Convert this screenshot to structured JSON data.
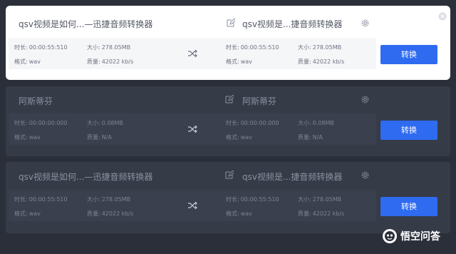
{
  "items": [
    {
      "src_name": "qsv视频是如何...—迅捷音频转换器",
      "dst_name": "qsv视频是...捷音频转换器",
      "src": {
        "duration_label": "时长:",
        "duration": "00:00:55:510",
        "size_label": "大小:",
        "size": "278.05MB",
        "format_label": "格式:",
        "format": "wav",
        "quality_label": "质量:",
        "quality": "42022 kb/s"
      },
      "dst": {
        "duration_label": "时长:",
        "duration": "00:00:55:510",
        "size_label": "大小:",
        "size": "278.05MB",
        "format_label": "格式:",
        "format": "wav",
        "quality_label": "质量:",
        "quality": "42022 kb/s"
      },
      "button": "转换"
    },
    {
      "src_name": "阿斯蒂芬",
      "dst_name": "阿斯蒂芬",
      "src": {
        "duration_label": "时长:",
        "duration": "00:00:00:000",
        "size_label": "大小:",
        "size": "0.08MB",
        "format_label": "格式:",
        "format": "wav",
        "quality_label": "质量:",
        "quality": "N/A"
      },
      "dst": {
        "duration_label": "时长:",
        "duration": "00:00:00:000",
        "size_label": "大小:",
        "size": "0.08MB",
        "format_label": "格式:",
        "format": "wav",
        "quality_label": "质量:",
        "quality": "N/A"
      },
      "button": "转换"
    },
    {
      "src_name": "qsv视频是如何...—迅捷音频转换器",
      "dst_name": "qsv视频是...捷音频转换器",
      "src": {
        "duration_label": "时长:",
        "duration": "00:00:55:510",
        "size_label": "大小:",
        "size": "278.05MB",
        "format_label": "格式:",
        "format": "wav",
        "quality_label": "质量:",
        "quality": "42022 kb/s"
      },
      "dst": {
        "duration_label": "时长:",
        "duration": "00:00:55:510",
        "size_label": "大小:",
        "size": "278.05MB",
        "format_label": "格式:",
        "format": "wav",
        "quality_label": "质量:",
        "quality": "42022 kb/s"
      },
      "button": "转换"
    }
  ],
  "watermark": {
    "text": "悟空问答",
    "icon": "wukong-logo-icon"
  },
  "colors": {
    "accent": "#2e6bf0",
    "background": "#2b2f3a",
    "card_inactive": "#363b48",
    "card_active": "#ffffff"
  }
}
